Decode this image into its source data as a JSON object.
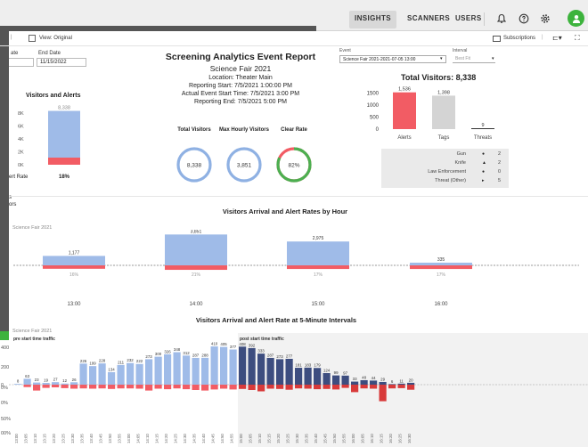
{
  "topnav": {
    "insights": "INSIGHTS",
    "scanners": "SCANNERS",
    "users": "USERS"
  },
  "toolbar": {
    "view_label": "View: Original",
    "subscriptions": "Subscriptions"
  },
  "filters": {
    "start_date_label": "ate",
    "end_date_label": "End Date",
    "end_date_value": "11/15/2022",
    "event_label": "Event",
    "event_value": "Science Fair 2021-2021-07-05 13:00",
    "interval_label": "Interval",
    "interval_value": "Best Fit"
  },
  "report": {
    "title": "Screening Analytics Event Report",
    "event_name": "Science Fair 2021",
    "location": "Location: Theater Main",
    "reporting_start": "Reporting Start: 7/5/2021 1:00:00 PM",
    "actual_start": "Actual Event Start Time: 7/5/2021 3:00 PM",
    "reporting_end": "Reporting End: 7/5/2021 5:00 PM"
  },
  "visitors_alerts": {
    "title": "Visitors  and Alerts",
    "bar_label": "8,338",
    "yticks": [
      "8K",
      "6K",
      "4K",
      "2K",
      "0K"
    ],
    "alert_rate_label": "ert Rate",
    "alert_rate_value": "18%",
    "visitors": 8338,
    "alerts": 1536
  },
  "kpis": [
    {
      "label": "Total Visitors",
      "value": "8,338",
      "color": "#8fb1e3",
      "fill": 1.0
    },
    {
      "label": "Max Hourly Visitors",
      "value": "3,851",
      "color": "#8fb1e3",
      "fill": 1.0
    },
    {
      "label": "Clear Rate",
      "value": "82%",
      "color": "#4caf50",
      "fill": 0.82
    }
  ],
  "totals": {
    "title": "Total Visitors: 8,338",
    "yticks": [
      "1500",
      "1000",
      "500",
      "0"
    ],
    "bars": [
      {
        "label": "Alerts",
        "value": 1536,
        "text": "1,536",
        "color": "#f25c64"
      },
      {
        "label": "Tags",
        "value": 1398,
        "text": "1,398",
        "color": "#d4d4d4"
      },
      {
        "label": "Threats",
        "value": 9,
        "text": "9",
        "color": "#333333"
      }
    ]
  },
  "threat_table": [
    {
      "name": "Gun",
      "icon": "dot",
      "count": "2"
    },
    {
      "name": "Knife",
      "icon": "triangle",
      "count": "2"
    },
    {
      "name": "Law Enforcement",
      "icon": "dot",
      "count": "0"
    },
    {
      "name": "Threat (Other)",
      "icon": "arrow",
      "count": "5"
    }
  ],
  "side_labels": {
    "a": "s",
    "b": "ors"
  },
  "hourly": {
    "title": "Visitors Arrival and Alert Rates by Hour",
    "event_label": "Science Fair 2021",
    "chart_data": {
      "type": "bar",
      "categories": [
        "13:00",
        "14:00",
        "15:00",
        "16:00"
      ],
      "series": [
        {
          "values": [
            1177,
            3851,
            2975,
            335
          ]
        },
        {
          "values": [
            16,
            21,
            17,
            17
          ]
        }
      ],
      "value_labels": [
        "1,177",
        "3,851",
        "2,975",
        "335"
      ],
      "rate_labels": [
        "16%",
        "21%",
        "17%",
        "17%"
      ]
    }
  },
  "interval": {
    "title": "Visitors Arrival and Alert Rate at 5-Minute Intervals",
    "event_label": "Science Fair 2021",
    "pre_label": "pre start time traffic",
    "post_label": "post start time traffic",
    "yticks_top": [
      "400",
      "200",
      "0"
    ],
    "yticks_bottom": [
      "0%",
      "0%",
      "50%",
      "00%"
    ],
    "chart_data": {
      "type": "bar",
      "categories": [
        "13:00",
        "13:05",
        "13:10",
        "13:15",
        "13:20",
        "13:25",
        "13:30",
        "13:35",
        "13:40",
        "13:45",
        "13:50",
        "13:55",
        "14:00",
        "14:05",
        "14:10",
        "14:15",
        "14:20",
        "14:25",
        "14:30",
        "14:35",
        "14:40",
        "14:45",
        "14:50",
        "14:55",
        "15:00",
        "15:05",
        "15:10",
        "15:15",
        "15:20",
        "15:25",
        "15:30",
        "15:35",
        "15:40",
        "15:45",
        "15:50",
        "15:55",
        "16:00",
        "16:05",
        "16:10",
        "16:15",
        "16:20",
        "16:25",
        "16:30"
      ],
      "series": [
        {
          "values": [
            8,
            63,
            23,
            19,
            27,
            12,
            26,
            226,
            199,
            228,
            134,
            211,
            232,
            222,
            273,
            300,
            326,
            348,
            312,
            287,
            288,
            410,
            405,
            377,
            408,
            392,
            333,
            287,
            273,
            277,
            181,
            183,
            179,
            124,
            99,
            97,
            33,
            48,
            44,
            29,
            6,
            11,
            20
          ]
        },
        {
          "values": [
            0,
            9,
            22,
            12,
            10,
            13,
            15,
            14,
            15,
            14,
            16,
            14,
            14,
            15,
            22,
            15,
            17,
            14,
            17,
            20,
            22,
            18,
            15,
            18,
            16,
            20,
            25,
            15,
            16,
            19,
            14,
            15,
            17,
            16,
            18,
            12,
            28,
            14,
            15,
            62,
            14,
            13,
            19
          ]
        }
      ],
      "value_labels": [
        "8",
        "63",
        "23",
        "19",
        "27",
        "12",
        "26",
        "226",
        "199",
        "228",
        "134",
        "211",
        "232",
        "222",
        "273",
        "300",
        "326",
        "348",
        "312",
        "287",
        "288",
        "410",
        "405",
        "377",
        "408",
        "392",
        "333",
        "287",
        "273",
        "277",
        "181",
        "183",
        "179",
        "124",
        "99",
        "97",
        "33",
        "48",
        "44",
        "29",
        "6",
        "11",
        "20"
      ],
      "post_start_index": 24,
      "ylim": [
        0,
        420
      ]
    }
  }
}
